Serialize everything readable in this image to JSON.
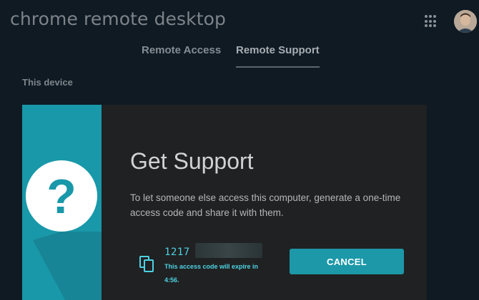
{
  "header": {
    "app_title": "chrome remote desktop",
    "apps_icon": "apps-grid-icon",
    "avatar_icon": "user-avatar"
  },
  "tabs": [
    {
      "label": "Remote Access",
      "active": false
    },
    {
      "label": "Remote Support",
      "active": true
    }
  ],
  "section": {
    "label": "This device"
  },
  "support_card": {
    "title": "Get Support",
    "description": "To let someone else access this computer, generate a one-time access code and share it with them.",
    "side_icon": "question-mark-icon",
    "access_code_prefix": "1217",
    "copy_icon": "copy-icon",
    "expiry_text": "This access code will expire in 4:56.",
    "cancel_label": "CANCEL"
  },
  "colors": {
    "background": "#0f1a23",
    "card": "#202122",
    "accent": "#1898a9",
    "code_text": "#4dd3e4"
  }
}
